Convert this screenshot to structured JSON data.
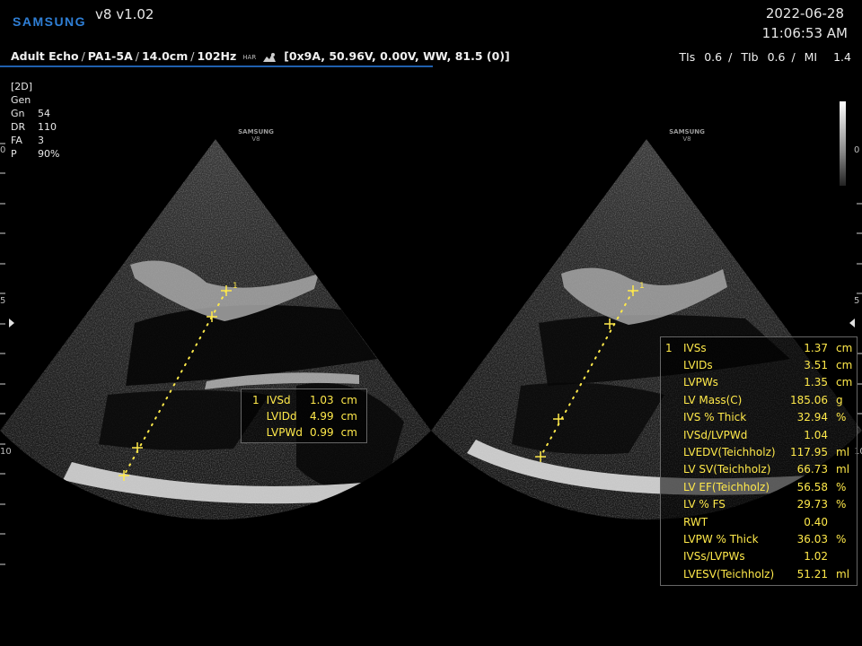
{
  "header": {
    "brand": "SAMSUNG",
    "software_version": "v8 v1.02",
    "date": "2022-06-28",
    "time": "11:06:53 AM"
  },
  "preset_bar": {
    "application": "Adult Echo",
    "probe": "PA1-5A",
    "depth": "14.0cm",
    "frame_rate": "102Hz",
    "har_label": "HAR",
    "info": "[0x9A, 50.96V, 0.00V, WW, 81.5 (0)]"
  },
  "safety_indices": {
    "tis_label": "TIs",
    "tis_value": "0.6",
    "tib_label": "TIb",
    "tib_value": "0.6",
    "mi_label": "MI",
    "mi_value": "1.4"
  },
  "image_params": {
    "mode": "[2D]",
    "preset": "Gen",
    "rows": [
      {
        "key": "Gn",
        "value": "54"
      },
      {
        "key": "DR",
        "value": "110"
      },
      {
        "key": "FA",
        "value": "3"
      },
      {
        "key": "P",
        "value": "90%"
      }
    ]
  },
  "depth_scale": {
    "left_labels": [
      "0",
      "5",
      "10"
    ],
    "right_labels": [
      "0",
      "5",
      "10"
    ]
  },
  "probe_watermark": {
    "line1": "SAMSUNG",
    "line2": "V8"
  },
  "left_measurements": {
    "index": "1",
    "rows": [
      {
        "label": "IVSd",
        "value": "1.03",
        "unit": "cm"
      },
      {
        "label": "LVIDd",
        "value": "4.99",
        "unit": "cm"
      },
      {
        "label": "LVPWd",
        "value": "0.99",
        "unit": "cm"
      }
    ]
  },
  "right_measurements": {
    "index": "1",
    "rows": [
      {
        "label": "IVSs",
        "value": "1.37",
        "unit": "cm"
      },
      {
        "label": "LVIDs",
        "value": "3.51",
        "unit": "cm"
      },
      {
        "label": "LVPWs",
        "value": "1.35",
        "unit": "cm"
      },
      {
        "label": "LV Mass(C)",
        "value": "185.06",
        "unit": "g"
      },
      {
        "label": "IVS % Thick",
        "value": "32.94",
        "unit": "%"
      },
      {
        "label": "IVSd/LVPWd",
        "value": "1.04",
        "unit": ""
      },
      {
        "label": "LVEDV(Teichholz)",
        "value": "117.95",
        "unit": "ml"
      },
      {
        "label": "LV SV(Teichholz)",
        "value": "66.73",
        "unit": "ml"
      },
      {
        "label": "LV EF(Teichholz)",
        "value": "56.58",
        "unit": "%"
      },
      {
        "label": "LV % FS",
        "value": "29.73",
        "unit": "%"
      },
      {
        "label": "RWT",
        "value": "0.40",
        "unit": ""
      },
      {
        "label": "LVPW % Thick",
        "value": "36.03",
        "unit": "%"
      },
      {
        "label": "IVSs/LVPWs",
        "value": "1.02",
        "unit": ""
      },
      {
        "label": "LVESV(Teichholz)",
        "value": "51.21",
        "unit": "ml"
      }
    ]
  },
  "caliper_labels": {
    "left": "1",
    "right": "1"
  },
  "colors": {
    "brand": "#2f7fd6",
    "measurement": "#ffe94a",
    "accent_line": "#1f5fae"
  }
}
